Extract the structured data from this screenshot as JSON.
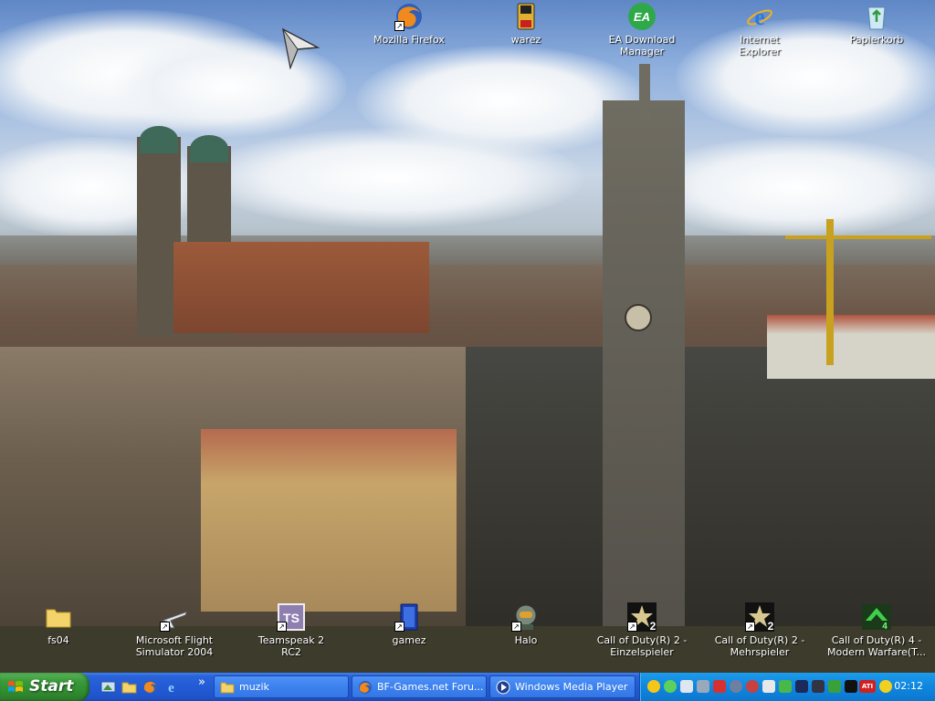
{
  "desktop_top_icons": [
    {
      "label": "Mozilla Firefox",
      "icon": "firefox-icon",
      "shortcut": true
    },
    {
      "label": "warez",
      "icon": "floppy-icon",
      "shortcut": false
    },
    {
      "label": "EA Download Manager",
      "icon": "ea-icon",
      "shortcut": false
    },
    {
      "label": "Internet Explorer",
      "icon": "ie-icon",
      "shortcut": false
    },
    {
      "label": "Papierkorb",
      "icon": "recycle-bin-icon",
      "shortcut": false
    }
  ],
  "desktop_bottom_icons": [
    {
      "label": "fs04",
      "icon": "folder-icon",
      "shortcut": false
    },
    {
      "label": "Microsoft Flight Simulator 2004",
      "icon": "flight-sim-icon",
      "shortcut": true
    },
    {
      "label": "Teamspeak 2 RC2",
      "icon": "teamspeak-icon",
      "shortcut": true
    },
    {
      "label": "gamez",
      "icon": "gamez-icon",
      "shortcut": true
    },
    {
      "label": "Halo",
      "icon": "halo-icon",
      "shortcut": true
    },
    {
      "label": "Call of Duty(R) 2 - Einzelspieler",
      "icon": "cod2-icon",
      "shortcut": true
    },
    {
      "label": "Call of Duty(R) 2 - Mehrspieler",
      "icon": "cod2-mp-icon",
      "shortcut": true
    },
    {
      "label": "Call of Duty(R) 4 - Modern Warfare(T...",
      "icon": "cod4-icon",
      "shortcut": false
    }
  ],
  "taskbar": {
    "start_label": "Start",
    "quick_launch_more": "»",
    "buttons": [
      {
        "label": "muzik",
        "icon": "folder-icon"
      },
      {
        "label": "BF-Games.net Foru...",
        "icon": "firefox-icon"
      },
      {
        "label": "Windows Media Player",
        "icon": "media-player-icon"
      }
    ],
    "clock": "02:12"
  },
  "colors": {
    "taskbar": "#235bd6",
    "start": "#3a9a3a",
    "tray": "#0f86de"
  }
}
